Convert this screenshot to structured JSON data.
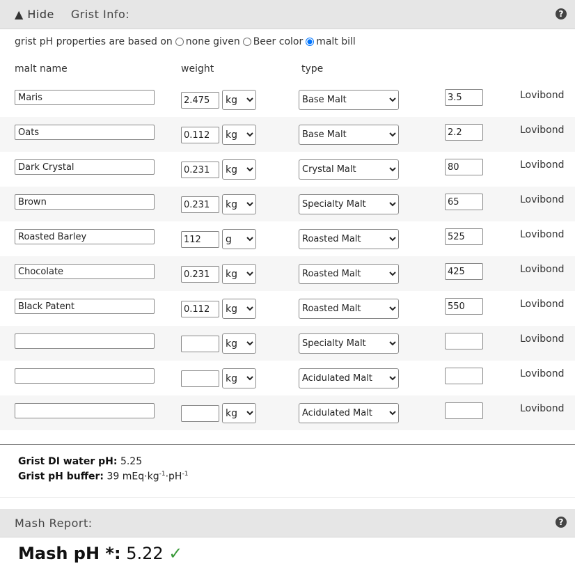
{
  "grist_panel": {
    "toggle_label": "▲ Hide",
    "title": "Grist Info:",
    "help_icon": "?"
  },
  "basis": {
    "prefix": "grist pH properties are based on",
    "options": [
      "none given",
      "Beer color",
      "malt bill"
    ],
    "selected": "malt bill"
  },
  "columns": {
    "name": "malt name",
    "weight": "weight",
    "type": "type"
  },
  "type_options": [
    "Base Malt",
    "Crystal Malt",
    "Specialty Malt",
    "Roasted Malt",
    "Acidulated Malt"
  ],
  "unit_options": [
    "kg",
    "g"
  ],
  "color_unit": "Lovibond",
  "malts": [
    {
      "name": "Maris",
      "weight": "2.475",
      "unit": "kg",
      "type": "Base Malt",
      "color": "3.5"
    },
    {
      "name": "Oats",
      "weight": "0.112",
      "unit": "kg",
      "type": "Base Malt",
      "color": "2.2"
    },
    {
      "name": "Dark Crystal",
      "weight": "0.231",
      "unit": "kg",
      "type": "Crystal Malt",
      "color": "80"
    },
    {
      "name": "Brown",
      "weight": "0.231",
      "unit": "kg",
      "type": "Specialty Malt",
      "color": "65"
    },
    {
      "name": "Roasted Barley",
      "weight": "112",
      "unit": "g",
      "type": "Roasted Malt",
      "color": "525"
    },
    {
      "name": "Chocolate",
      "weight": "0.231",
      "unit": "kg",
      "type": "Roasted Malt",
      "color": "425"
    },
    {
      "name": "Black Patent",
      "weight": "0.112",
      "unit": "kg",
      "type": "Roasted Malt",
      "color": "550"
    },
    {
      "name": "",
      "weight": "",
      "unit": "kg",
      "type": "Specialty Malt",
      "color": ""
    },
    {
      "name": "",
      "weight": "",
      "unit": "kg",
      "type": "Acidulated Malt",
      "color": ""
    },
    {
      "name": "",
      "weight": "",
      "unit": "kg",
      "type": "Acidulated Malt",
      "color": ""
    }
  ],
  "summary": {
    "di_label": "Grist DI water pH:",
    "di_value": "5.25",
    "buffer_label": "Grist pH buffer:",
    "buffer_value": "39 mEq·kg",
    "buffer_exp1": "-1",
    "buffer_mid": "·pH",
    "buffer_exp2": "-1"
  },
  "mash_panel": {
    "title": "Mash Report:",
    "help_icon": "?",
    "ph_label": "Mash pH *:",
    "ph_value": "5.22",
    "check": "✓"
  },
  "colors": {
    "header_bg": "#e6e6e6",
    "alt_row_bg": "#f6f6f6",
    "check_green": "#3a9a3a"
  }
}
